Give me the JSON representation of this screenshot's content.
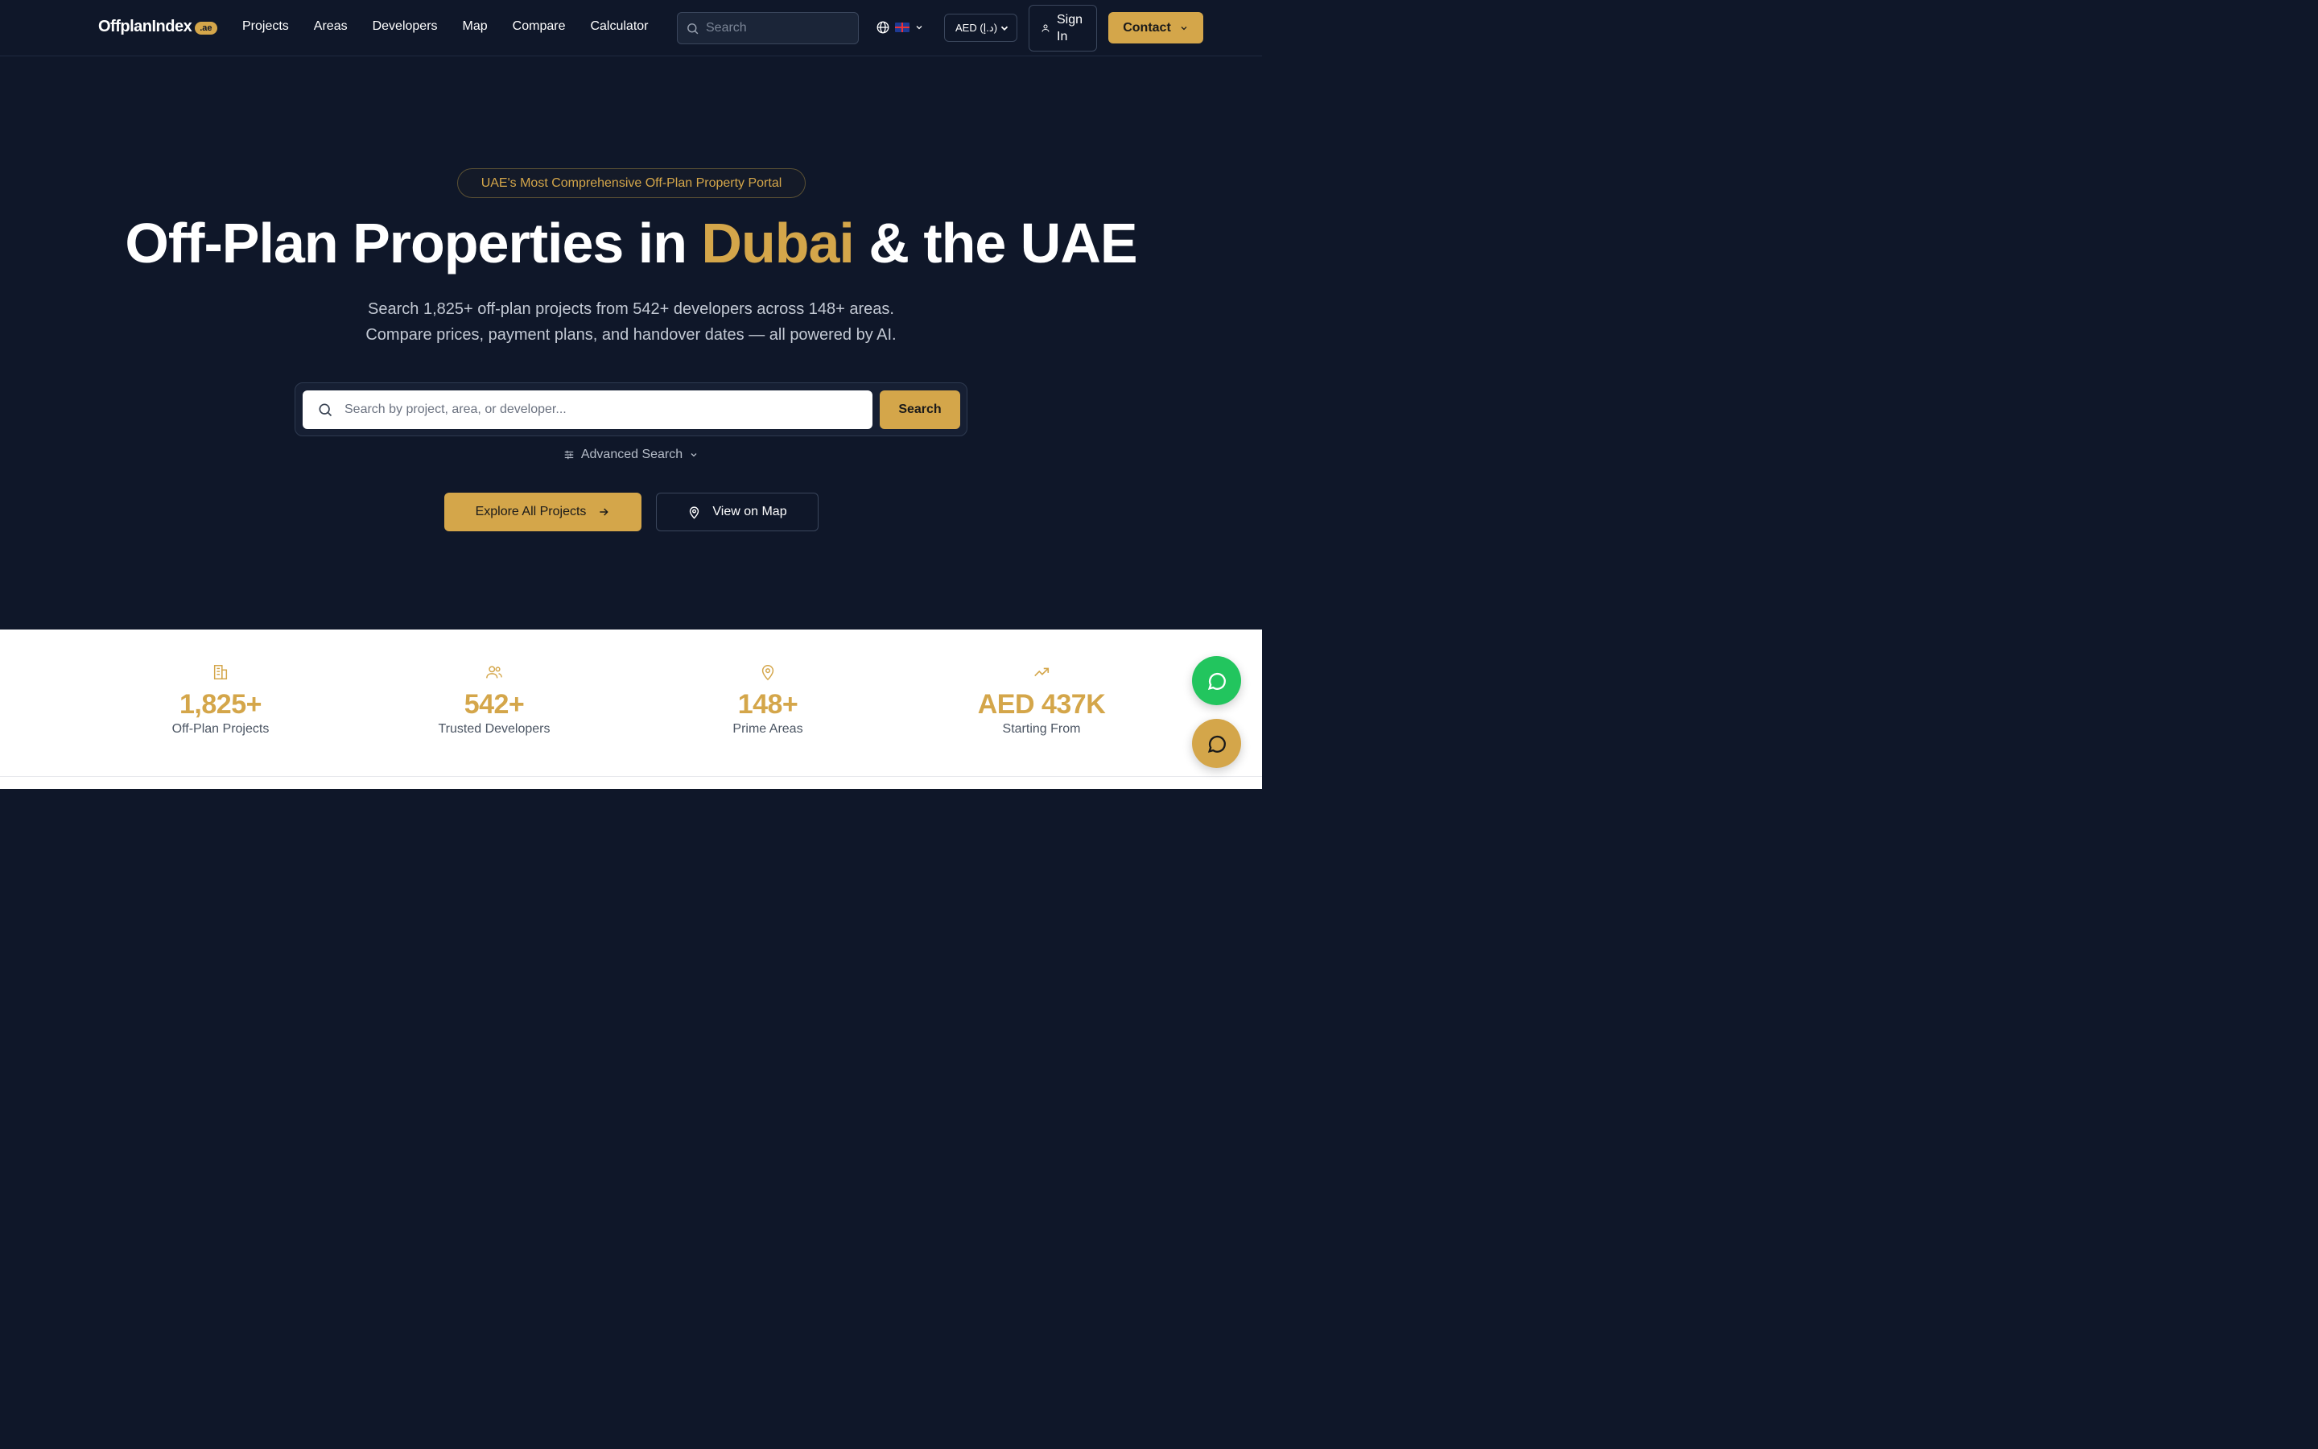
{
  "nav": {
    "logo_text": "OffplanIndex",
    "logo_badge": ".ae",
    "links": [
      "Projects",
      "Areas",
      "Developers",
      "Map",
      "Compare",
      "Calculator"
    ],
    "search_placeholder": "Search",
    "currency": "AED (د.إ)",
    "sign_in": "Sign In",
    "contact": "Contact"
  },
  "hero": {
    "pill": "UAE's Most Comprehensive Off-Plan Property Portal",
    "title_pre": "Off-Plan Properties in ",
    "title_accent": "Dubai",
    "title_post": " & the UAE",
    "subtitle_line1": "Search 1,825+ off-plan projects from 542+ developers across 148+ areas.",
    "subtitle_line2": "Compare prices, payment plans, and handover dates — all powered by AI.",
    "search_placeholder": "Search by project, area, or developer...",
    "search_button": "Search",
    "advanced_search": "Advanced Search",
    "explore_button": "Explore All Projects",
    "map_button": "View on Map"
  },
  "stats": [
    {
      "icon": "building-icon",
      "value": "1,825+",
      "label": "Off-Plan Projects"
    },
    {
      "icon": "users-icon",
      "value": "542+",
      "label": "Trusted Developers"
    },
    {
      "icon": "map-pin-icon",
      "value": "148+",
      "label": "Prime Areas"
    },
    {
      "icon": "trending-up-icon",
      "value": "AED 437K",
      "label": "Starting From"
    }
  ],
  "colors": {
    "background": "#0f1729",
    "accent": "#d4a64a",
    "whatsapp": "#22c55e"
  }
}
